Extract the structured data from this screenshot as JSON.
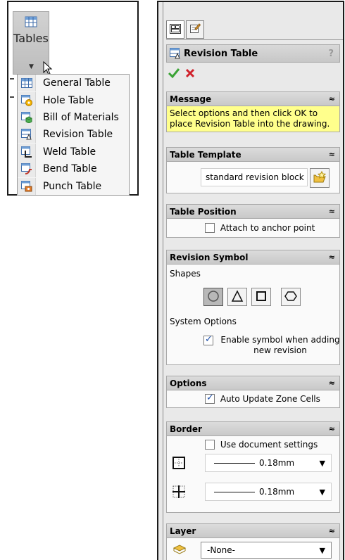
{
  "tables_menu": {
    "button_label": "Tables",
    "items": [
      {
        "label": "General Table",
        "icon": "general-table-icon"
      },
      {
        "label": "Hole Table",
        "icon": "hole-table-icon"
      },
      {
        "label": "Bill of Materials",
        "icon": "bill-of-materials-icon"
      },
      {
        "label": "Revision Table",
        "icon": "revision-table-icon"
      },
      {
        "label": "Weld Table",
        "icon": "weld-table-icon"
      },
      {
        "label": "Bend Table",
        "icon": "bend-table-icon"
      },
      {
        "label": "Punch Table",
        "icon": "punch-table-icon"
      }
    ]
  },
  "property_manager": {
    "title": "Revision Table",
    "help": "?",
    "message": {
      "header": "Message",
      "text": "Select options and then click OK to place Revision Table into the drawing."
    },
    "table_template": {
      "header": "Table Template",
      "value": "standard revision block"
    },
    "table_position": {
      "header": "Table Position",
      "attach_label": "Attach to anchor point",
      "attach_checked": false
    },
    "revision_symbol": {
      "header": "Revision Symbol",
      "shapes_label": "Shapes",
      "shapes": [
        "circle",
        "triangle",
        "square",
        "hexagon"
      ],
      "selected_shape": "circle",
      "system_options_label": "System Options",
      "enable_label": "Enable symbol when adding new revision",
      "enable_checked": true
    },
    "options": {
      "header": "Options",
      "auto_update_label": "Auto Update Zone Cells",
      "auto_update_checked": true
    },
    "border": {
      "header": "Border",
      "use_doc_label": "Use document settings",
      "use_doc_checked": false,
      "box_border_value": "0.18mm",
      "grid_border_value": "0.18mm"
    },
    "layer": {
      "header": "Layer",
      "value": "-None-"
    }
  },
  "colors": {
    "message_bg": "#ffff8c",
    "ok": "#3aa335",
    "cancel": "#d0202a",
    "checkmark": "#1e4fa8"
  }
}
